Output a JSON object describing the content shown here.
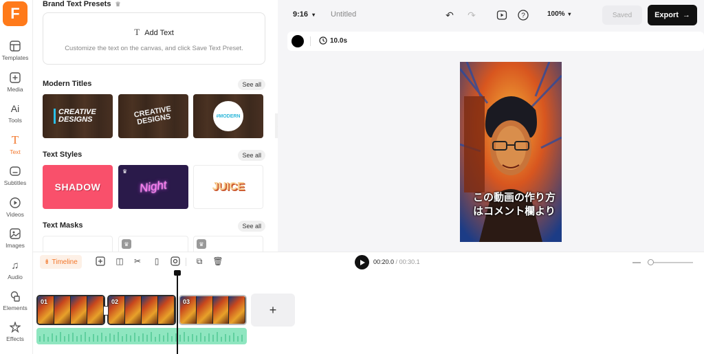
{
  "rail": {
    "items": [
      {
        "label": "Templates",
        "icon": "templates-icon"
      },
      {
        "label": "Media",
        "icon": "media-icon"
      },
      {
        "label": "Tools",
        "icon": "ai-tools-icon"
      },
      {
        "label": "Text",
        "icon": "text-icon"
      },
      {
        "label": "Subtitles",
        "icon": "subtitles-icon"
      },
      {
        "label": "Videos",
        "icon": "videos-icon"
      },
      {
        "label": "Images",
        "icon": "images-icon"
      },
      {
        "label": "Audio",
        "icon": "audio-icon"
      },
      {
        "label": "Elements",
        "icon": "elements-icon"
      },
      {
        "label": "Effects",
        "icon": "effects-icon"
      }
    ],
    "active": "Text"
  },
  "panel": {
    "brand_title": "Brand Text Presets",
    "add_text": "Add Text",
    "preset_hint": "Customize the text on the canvas, and click Save Text Preset.",
    "sections": [
      {
        "title": "Modern Titles",
        "see_all": "See all",
        "thumbs": [
          "CREATIVE DESIGNS",
          "CREATIVE DESIGNS",
          "#MODERN"
        ]
      },
      {
        "title": "Text Styles",
        "see_all": "See all",
        "thumbs": [
          "SHADOW",
          "Night",
          "JUICE"
        ]
      },
      {
        "title": "Text Masks",
        "see_all": "See all",
        "thumbs": [
          "",
          "",
          ""
        ]
      }
    ]
  },
  "topbar": {
    "ratio": "9:16",
    "title": "Untitled",
    "zoom": "100%",
    "saved": "Saved",
    "export": "Export"
  },
  "subbar": {
    "duration": "10.0s",
    "color": "#000000"
  },
  "canvas": {
    "caption": "この動画の作り方はコメント欄より"
  },
  "timeline": {
    "tab": "Timeline",
    "current_time": "00:20.0",
    "total_time": "00:30.1",
    "clips": [
      "01",
      "02",
      "03"
    ],
    "add_label": "+"
  },
  "colors": {
    "accent": "#f2762a",
    "brand": "#ff7a1a",
    "shadow_tile": "#f9506b",
    "night_tile": "#2a1a4a",
    "audio": "#8fe6c0"
  }
}
